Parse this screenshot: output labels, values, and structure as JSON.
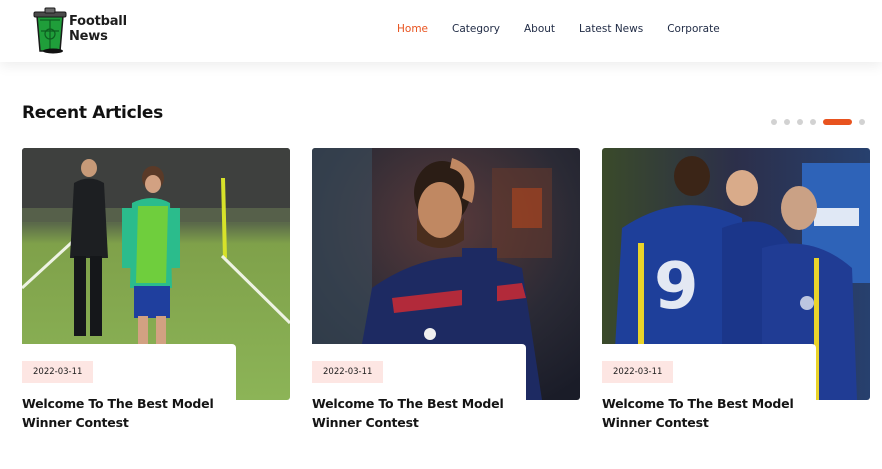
{
  "header": {
    "logo_line1": "Football",
    "logo_line2": "News",
    "nav": [
      {
        "label": "Home",
        "active": true
      },
      {
        "label": "Category"
      },
      {
        "label": "About"
      },
      {
        "label": "Latest News"
      },
      {
        "label": "Corporate"
      }
    ]
  },
  "colors": {
    "accent": "#e8531f",
    "badge_bg": "#fde6e3",
    "nav_text": "#1f2a44"
  },
  "section": {
    "title": "Recent Articles",
    "slider_dots": 6,
    "active_dot": 5
  },
  "articles": [
    {
      "date": "2022-03-11",
      "title": "Welcome To The Best Model Winner Contest",
      "image": "training-field-photo"
    },
    {
      "date": "2022-03-11",
      "title": "Welcome To The Best Model Winner Contest",
      "image": "player-facepalm-photo"
    },
    {
      "date": "2022-03-11",
      "title": "Welcome To The Best Model Winner Contest",
      "image": "team-celebration-photo"
    }
  ]
}
